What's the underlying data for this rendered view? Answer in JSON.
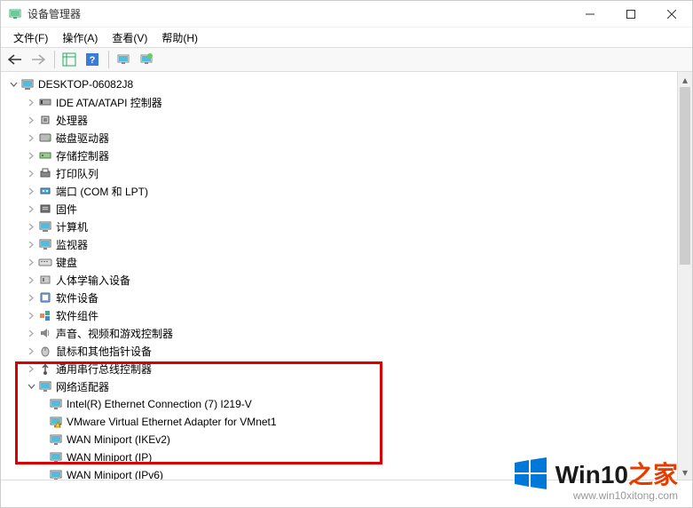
{
  "window": {
    "title": "设备管理器"
  },
  "menu": {
    "file": "文件(F)",
    "action": "操作(A)",
    "view": "查看(V)",
    "help": "帮助(H)"
  },
  "tree": {
    "root": "DESKTOP-06082J8",
    "nodes": [
      "IDE ATA/ATAPI 控制器",
      "处理器",
      "磁盘驱动器",
      "存储控制器",
      "打印队列",
      "端口 (COM 和 LPT)",
      "固件",
      "计算机",
      "监视器",
      "键盘",
      "人体学输入设备",
      "软件设备",
      "软件组件",
      "声音、视频和游戏控制器",
      "鼠标和其他指针设备",
      "通用串行总线控制器",
      "网络适配器"
    ],
    "network_children": [
      "Intel(R) Ethernet Connection (7) I219-V",
      "VMware Virtual Ethernet Adapter for VMnet1",
      "WAN Miniport (IKEv2)",
      "WAN Miniport (IP)",
      "WAN Miniport (IPv6)"
    ]
  },
  "watermark": {
    "brand_prefix": "Win10",
    "brand_suffix": "之家",
    "url": "www.win10xitong.com"
  }
}
